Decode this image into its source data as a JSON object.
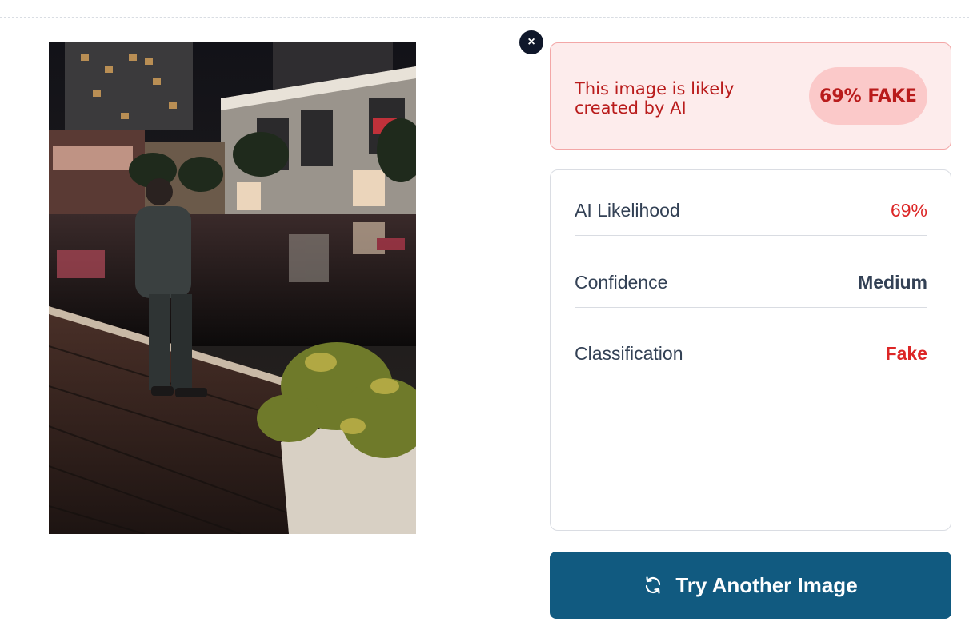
{
  "preview": {
    "image_description_icon": "photo-night-plaza"
  },
  "close": {
    "label": "×",
    "icon": "close-icon"
  },
  "verdict": {
    "message": "This image is likely created by AI",
    "badge": "69% FAKE"
  },
  "stats": {
    "rows": [
      {
        "label": "AI Likelihood",
        "value": "69%"
      },
      {
        "label": "Confidence",
        "value": "Medium"
      },
      {
        "label": "Classification",
        "value": "Fake"
      }
    ]
  },
  "action": {
    "label": "Try Another Image",
    "icon": "refresh-icon"
  },
  "colors": {
    "danger": "#dc2626",
    "danger_bg": "#fdecec",
    "primary": "#115a80"
  }
}
